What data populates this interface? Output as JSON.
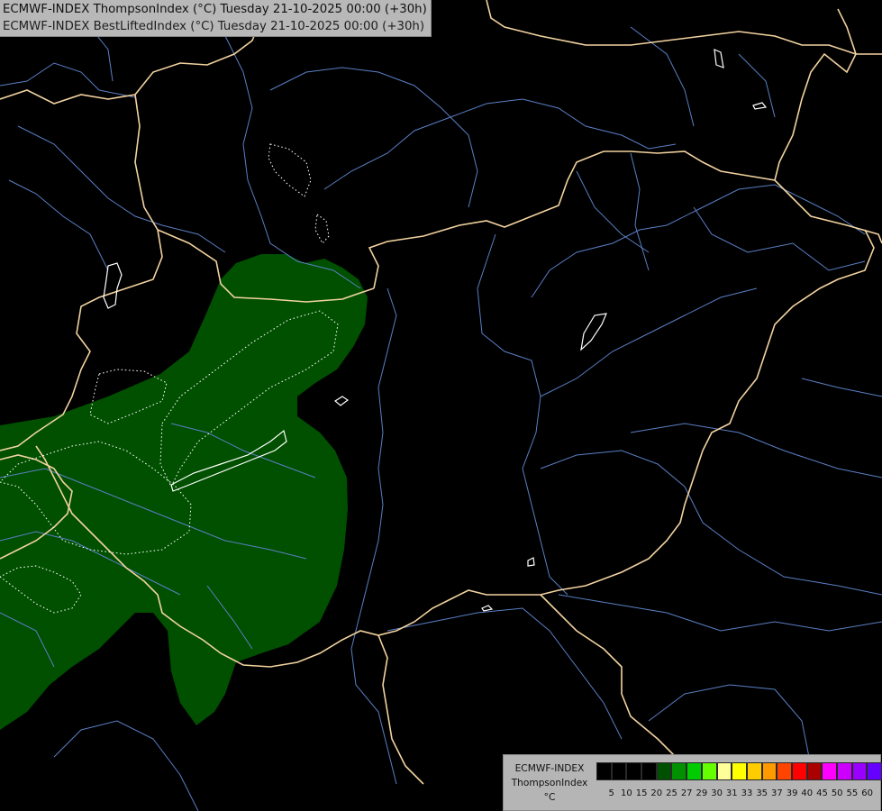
{
  "header": {
    "line1": "ECMWF-INDEX ThompsonIndex (°C) Tuesday 21-10-2025 00:00 (+30h)",
    "line2": "ECMWF-INDEX BestLiftedIndex (°C) Tuesday 21-10-2025 00:00 (+30h)"
  },
  "legend": {
    "model": "ECMWF-INDEX",
    "parameter": "ThompsonIndex",
    "unit": "°C",
    "colors": [
      "#000000",
      "#000000",
      "#000000",
      "#000000",
      "#005000",
      "#009000",
      "#00cc00",
      "#66ff00",
      "#ffff99",
      "#ffff00",
      "#ffcc00",
      "#ff9900",
      "#ff4400",
      "#ff0000",
      "#aa0000",
      "#ff00ff",
      "#cc00ff",
      "#9900ff",
      "#6600ff",
      "#0000ff"
    ],
    "ticks": [
      "5",
      "10",
      "15",
      "20",
      "25",
      "27",
      "29",
      "30",
      "31",
      "33",
      "35",
      "37",
      "39",
      "40",
      "45",
      "50",
      "55",
      "60"
    ]
  },
  "map_layers": {
    "background": "#000000",
    "shaded_area_color": "#005000",
    "country_border_color": "#f2d3a0",
    "river_color": "#5a7fc4",
    "contour_color": "#ffffff"
  }
}
